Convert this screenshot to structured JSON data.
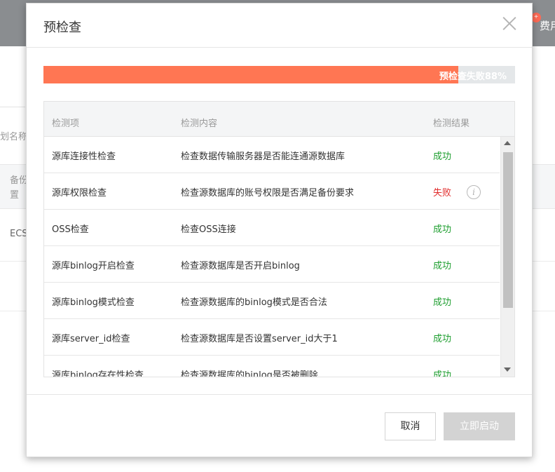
{
  "background": {
    "badge": "+",
    "fee_text": "费用",
    "search_placeholder": "划名称",
    "col_header_line1": "备份",
    "col_header_line2": "置",
    "row_text": "ECS"
  },
  "modal": {
    "title": "预检查",
    "progress": {
      "label": "预检查失败88%",
      "percent": 88,
      "color": "#ff7653"
    },
    "table": {
      "headers": [
        "检测项",
        "检测内容",
        "检测结果"
      ],
      "rows": [
        {
          "item": "源库连接性检查",
          "content": "检查数据传输服务器是否能连通源数据库",
          "result": "成功",
          "status": "ok"
        },
        {
          "item": "源库权限检查",
          "content": "检查源数据库的账号权限是否满足备份要求",
          "result": "失败",
          "status": "fail",
          "info_icon": "i"
        },
        {
          "item": "OSS检查",
          "content": "检查OSS连接",
          "result": "成功",
          "status": "ok"
        },
        {
          "item": "源库binlog开启检查",
          "content": "检查源数据库是否开启binlog",
          "result": "成功",
          "status": "ok"
        },
        {
          "item": "源库binlog模式检查",
          "content": "检查源数据库的binlog模式是否合法",
          "result": "成功",
          "status": "ok"
        },
        {
          "item": "源库server_id检查",
          "content": "检查源数据库是否设置server_id大于1",
          "result": "成功",
          "status": "ok"
        },
        {
          "item": "源库binlog存在性检查",
          "content": "检查源数据库的binlog是否被删除",
          "result": "成功",
          "status": "ok"
        }
      ]
    },
    "buttons": {
      "cancel": "取消",
      "start": "立即启动"
    },
    "colors": {
      "success": "#1e9e2f",
      "failure": "#e12c2c"
    }
  }
}
